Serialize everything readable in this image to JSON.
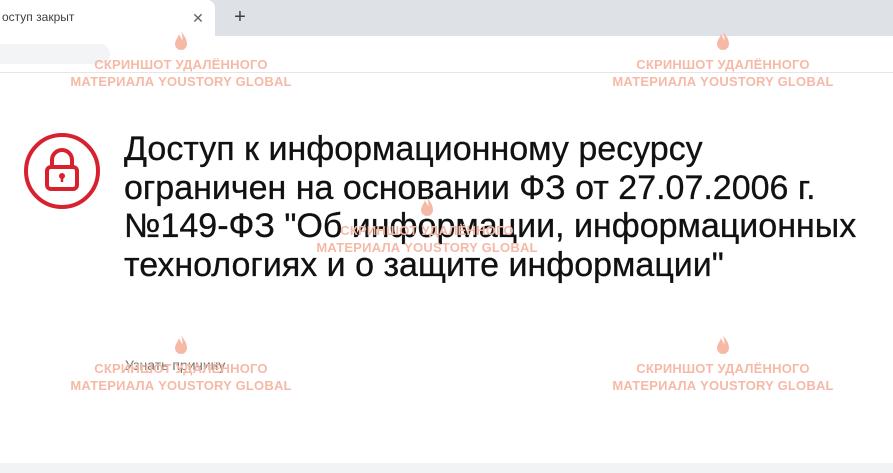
{
  "browser": {
    "tab_title": "оступ закрыт",
    "tab_close_glyph": "✕",
    "new_tab_glyph": "+"
  },
  "page": {
    "headline": "Доступ к информационному ресурсу ограничен на основании ФЗ от 27.07.2006 г. №149-ФЗ \"Об информации, информационных технологиях и о защите информации\"",
    "reason_link": "Узнать причину"
  },
  "watermark": {
    "line1": "СКРИНШОТ УДАЛЁННОГО",
    "line2": "МАТЕРИАЛА YOUSTORY GLOBAL",
    "color": "#f6b9a6",
    "icon": "flame-icon"
  },
  "colors": {
    "lock_red": "#d8202f",
    "tab_strip": "#dee1e6"
  },
  "icons": {
    "lock": "lock-icon",
    "close": "close-icon",
    "new_tab": "plus-icon"
  }
}
